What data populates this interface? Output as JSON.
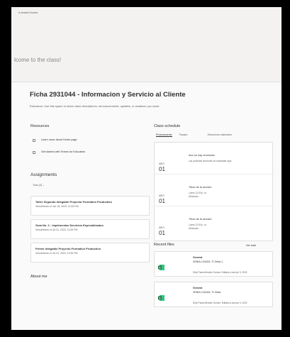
{
  "banner": {
    "tag": "# started books",
    "welcome": "lcome to the class!"
  },
  "page": {
    "title": "Ficha 2931044 - Informacion y Servicio al Cliente",
    "subtitle": "Educators: Use this space to share class descriptions, announcements, updates, or whatever you want."
  },
  "resources": {
    "heading": "Resources",
    "items": [
      {
        "label": "Learn more about Home page"
      },
      {
        "label": "Get started with Teams for Education"
      }
    ]
  },
  "assignments": {
    "heading": "Assignments",
    "filter": "Todo (3) ⌄",
    "items": [
      {
        "title": "Taller Segundo Integable Proyecto Formativo Productivo",
        "due": "Vencimiento el Jun 15, 2023, 11:59 PM"
      },
      {
        "title": "Guia No. 2 - Implementar Servicios Especializados",
        "due": "Vencimiento el Jul 31, 2023, 11:59 PM"
      },
      {
        "title": "Primer Integable Proyecto Formativo Productivo",
        "due": "Vencimiento el Jul 31, 2023, 11:59 PM"
      }
    ]
  },
  "about": {
    "heading": "About me"
  },
  "schedule": {
    "heading": "Class schedule",
    "tabs": [
      "Próximamente",
      "Pasado"
    ],
    "calendar_tab": "Sincronizar calendario",
    "events": [
      {
        "month": "MES",
        "day": "01",
        "title": "Aún no hay reuniones",
        "sub1": "Las próximas reuniones se mostrarán aquí",
        "sub2": ""
      },
      {
        "month": "MES",
        "day": "01",
        "title": "Título de la reunión",
        "sub1": "Lunes 12:00 p. m.",
        "sub2": "Ubicación"
      },
      {
        "month": "MES",
        "day": "01",
        "title": "Título de la reunión",
        "sub1": "Lunes 12:00 p. m.",
        "sub2": "Ubicación"
      }
    ]
  },
  "recent_files": {
    "heading": "Recent files",
    "see_all": "Ver todo",
    "items": [
      {
        "channel": "General",
        "name": "XENIA LOAIZA, TI Zelsa 1",
        "meta": "Dirty Paola Mendez Gomez: Editado a las Apr 3, 2023"
      },
      {
        "channel": "General",
        "name": "XENIA LOAIZA, TI Zelsa",
        "meta": "Dirty Paola Mendez Gomez: Editado a las Apr 3, 2023"
      }
    ]
  },
  "colors": {
    "excel_green": "#217346",
    "background": "#fafafa",
    "banner": "#f3f2f1"
  }
}
